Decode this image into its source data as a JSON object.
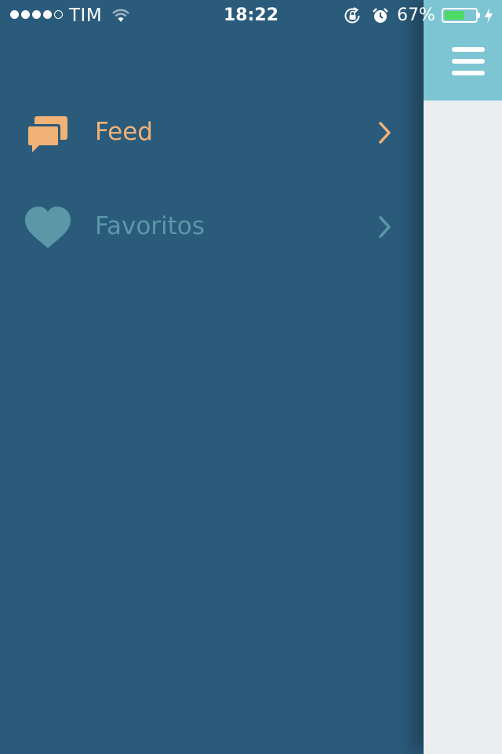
{
  "status_bar": {
    "carrier": "TIM",
    "time": "18:22",
    "battery_percent": "67%",
    "battery_level": 0.67,
    "signal_bars": 4,
    "signal_max": 5
  },
  "menu": {
    "items": [
      {
        "label": "Feed",
        "icon": "chat-bubbles-icon",
        "color": "#f0b277",
        "active": true
      },
      {
        "label": "Favoritos",
        "icon": "heart-icon",
        "color": "#5a98a8",
        "active": false
      }
    ]
  },
  "content": {
    "nav_color": "#7dc5d3",
    "menu_button_icon": "hamburger-menu-icon"
  },
  "colors": {
    "drawer_background": "#2b5b7b",
    "accent_active": "#f0b277",
    "inactive": "#5a98a8"
  }
}
